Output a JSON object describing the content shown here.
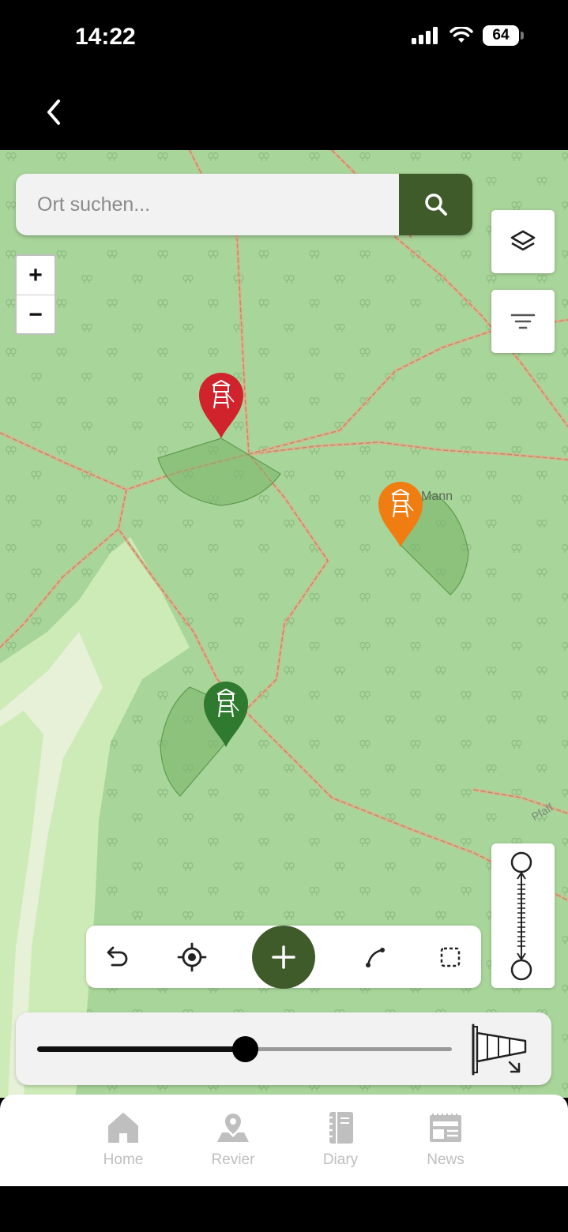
{
  "status_bar": {
    "time": "14:22",
    "battery": "64"
  },
  "search": {
    "placeholder": "Ort suchen..."
  },
  "zoom": {
    "in_label": "+",
    "out_label": "−"
  },
  "map": {
    "place_label": "Mann",
    "road_label": "Pfaff"
  },
  "wind": {
    "level": 0.5
  },
  "tabs": [
    {
      "label": "Home"
    },
    {
      "label": "Revier"
    },
    {
      "label": "Diary"
    },
    {
      "label": "News"
    }
  ],
  "colors": {
    "accent": "#3f5b2a",
    "map_bg": "#a8d59a",
    "pin_red": "#d0232b",
    "pin_orange": "#f07d12",
    "pin_green": "#2f7a2f"
  },
  "icons": [
    "back-icon",
    "search-icon",
    "layers-icon",
    "filter-icon",
    "undo-icon",
    "locate-icon",
    "plus-icon",
    "draw-line-icon",
    "select-area-icon",
    "measure-icon",
    "windsock-icon",
    "home-icon",
    "revier-icon",
    "diary-icon",
    "news-icon",
    "hunting-stand-icon"
  ]
}
